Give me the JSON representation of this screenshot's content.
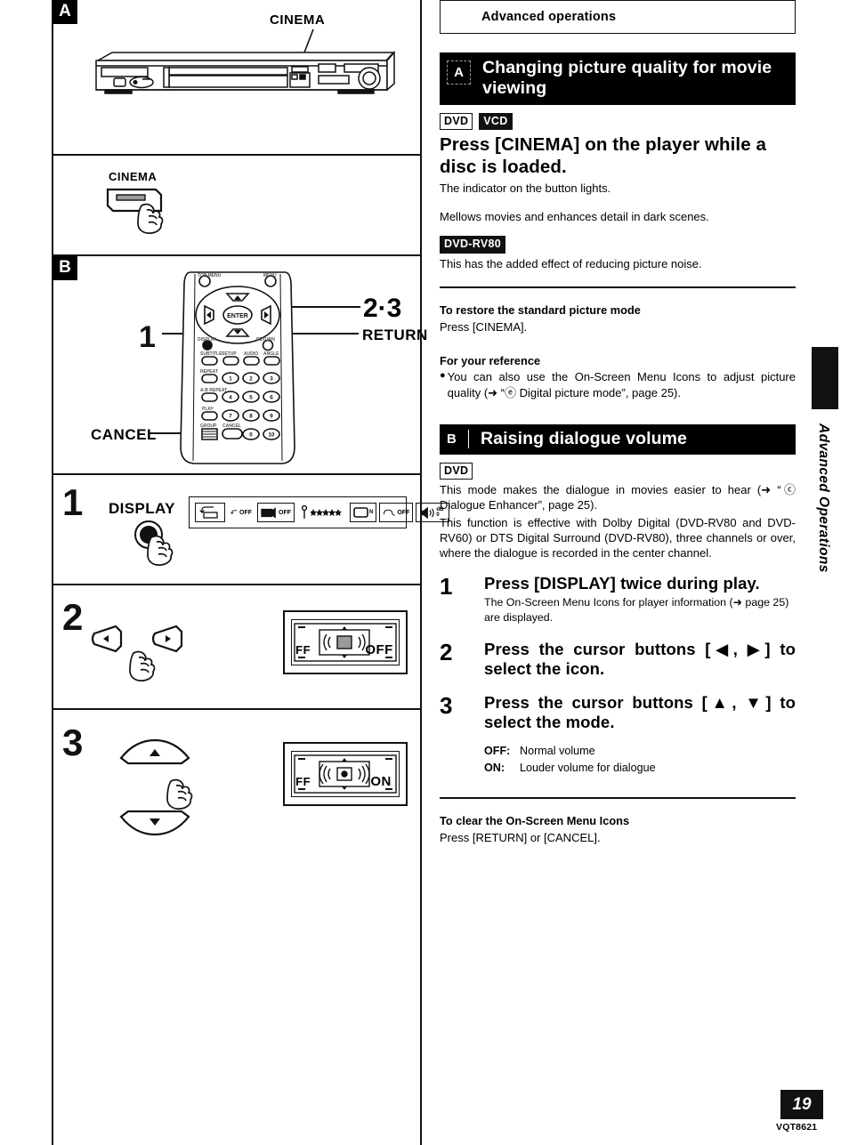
{
  "page": {
    "number": "19",
    "doc_code": "VQT8621",
    "side_tab": "Advanced Operations",
    "top_box_title": "Advanced operations"
  },
  "left_column": {
    "panels": [
      {
        "badge": "A",
        "name": "player-front-panel",
        "callouts": [
          {
            "label": "CINEMA"
          }
        ]
      },
      {
        "name": "cinema-button-press",
        "callouts": [
          {
            "label": "CINEMA"
          }
        ]
      },
      {
        "badge": "B",
        "name": "remote-control",
        "callouts": [
          {
            "label": "1"
          },
          {
            "label": "2·3"
          },
          {
            "label": "RETURN"
          },
          {
            "label": "CANCEL"
          }
        ]
      },
      {
        "step": "1",
        "name": "display-button-step",
        "callouts": [
          {
            "label": "DISPLAY"
          }
        ]
      },
      {
        "step": "2",
        "name": "left-right-cursor-step",
        "screen_label": "OFF",
        "screen_left_label": "FF"
      },
      {
        "step": "3",
        "name": "up-down-cursor-step",
        "screen_label": "ON",
        "screen_left_label": "FF"
      }
    ],
    "osd_icons": [
      {
        "name": "repeat-play-icon",
        "label": ""
      },
      {
        "name": "repeat-mode-icon",
        "label": "OFF"
      },
      {
        "name": "marker-icon",
        "label": "OFF"
      },
      {
        "name": "picture-mode-icon",
        "label": ""
      },
      {
        "name": "screen-mode-icon",
        "label": "N"
      },
      {
        "name": "play-speed-icon",
        "label": "OFF"
      },
      {
        "name": "dialogue-enhancer-icon",
        "label": "dB 0"
      }
    ]
  },
  "right_column": {
    "section_a": {
      "letter": "A",
      "title": "Changing picture quality for movie viewing",
      "badges": [
        {
          "text": "DVD",
          "style": "outline"
        },
        {
          "text": "VCD",
          "style": "inverted"
        }
      ],
      "statement": "Press [CINEMA] on the player while a disc is loaded.",
      "statement_note": "The indicator on the button lights.",
      "description": "Mellows movies and enhances detail in dark scenes.",
      "model_badge": {
        "text": "DVD-RV80",
        "style": "inverted"
      },
      "model_note": "This has the added effect of reducing picture noise.",
      "restore_heading": "To restore the standard picture mode",
      "restore_text": "Press [CINEMA].",
      "reference_heading": "For your reference",
      "reference_bullet": "You can also use the On-Screen Menu Icons to adjust picture quality (➜ “ⓔ Digital picture mode”, page 25)."
    },
    "section_b": {
      "letter": "B",
      "title": "Raising dialogue volume",
      "badges": [
        {
          "text": "DVD",
          "style": "outline"
        }
      ],
      "intro_1": "This mode makes the dialogue in movies easier to hear (➜ “ⓒ Dialogue Enhancer”, page 25).",
      "intro_2": "This function is effective with Dolby Digital (DVD-RV80 and DVD-RV60) or DTS Digital Surround (DVD-RV80), three channels or over, where the dialogue is recorded in the center channel.",
      "steps": [
        {
          "number": "1",
          "heading": "Press [DISPLAY] twice during play.",
          "detail": "The On-Screen Menu Icons for player information (➜ page 25) are displayed."
        },
        {
          "number": "2",
          "heading": "Press the cursor buttons [◀, ▶] to select the icon.",
          "detail": ""
        },
        {
          "number": "3",
          "heading": "Press the cursor buttons [▲, ▼] to select the mode.",
          "detail": ""
        }
      ],
      "modes": [
        {
          "key": "OFF:",
          "value": "Normal volume"
        },
        {
          "key": "ON:",
          "value": "Louder volume for dialogue"
        }
      ],
      "clear_heading": "To clear the On-Screen Menu Icons",
      "clear_text": "Press [RETURN] or [CANCEL]."
    }
  }
}
